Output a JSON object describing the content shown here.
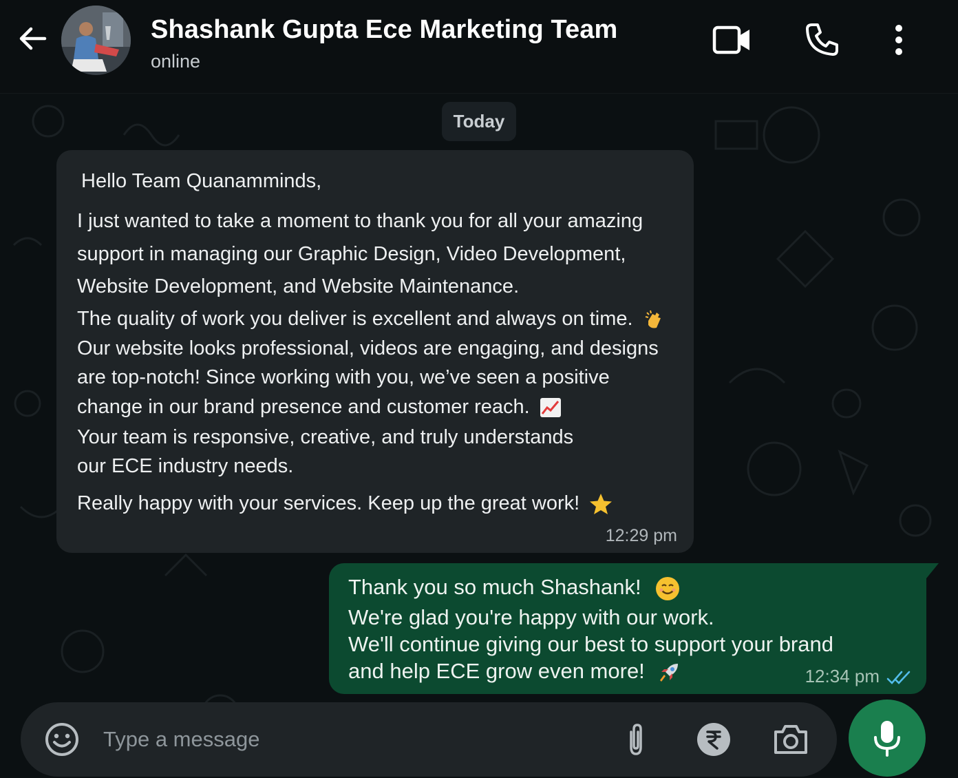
{
  "header": {
    "contact_name": "Shashank Gupta Ece Marketing Team",
    "status": "online",
    "icons": [
      "back-arrow-icon",
      "video-call-icon",
      "voice-call-icon",
      "more-options-icon"
    ]
  },
  "chat": {
    "date_chip": "Today",
    "incoming": {
      "lines": [
        "Hello Team Quanamminds,",
        "I just wanted to take a moment to thank you for all your amazing",
        "support in managing our Graphic Design, Video Development,",
        "Website Development, and Website Maintenance.",
        "The quality of work you deliver is excellent and always on time.",
        "Our website looks professional, videos are engaging, and designs",
        "are top-notch! Since working with you, we’ve seen a positive",
        "change in our brand presence and customer reach.",
        "Your team is responsive, creative, and truly understands",
        "our ECE industry needs.",
        "Really happy with your services. Keep up the great work!"
      ],
      "emojis": [
        "clapping-hands",
        "chart-increasing",
        "star"
      ],
      "time": "12:29 pm"
    },
    "outgoing": {
      "lines": [
        "Thank you so much Shashank!",
        "We're glad you're happy with our work.",
        "We'll continue giving our best to support your brand",
        "and help ECE grow even more!"
      ],
      "emojis": [
        "smiling-face",
        "rocket"
      ],
      "time": "12:34 pm",
      "status": "read"
    }
  },
  "composer": {
    "placeholder": "Type a message",
    "icons": [
      "emoji-icon",
      "attach-icon",
      "rupee-payment-icon",
      "camera-icon",
      "mic-icon"
    ]
  },
  "colors": {
    "background": "#0b0f11",
    "incoming_bubble": "#1f2427",
    "outgoing_bubble": "#0c4a30",
    "accent_green": "#1a7f4e",
    "read_ticks": "#53bdeb"
  }
}
